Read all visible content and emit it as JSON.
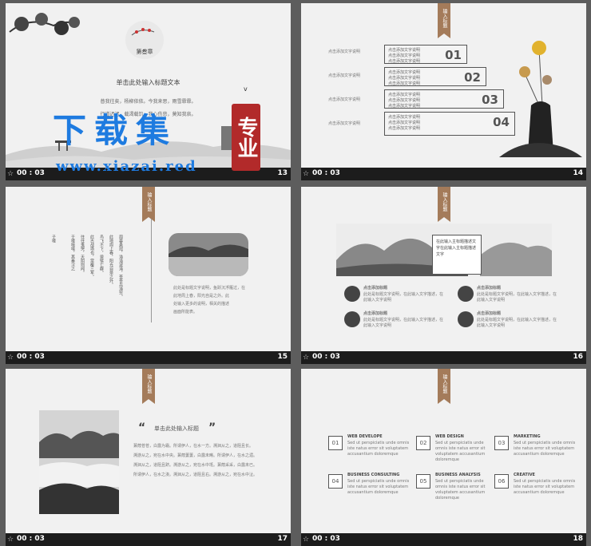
{
  "slides": {
    "s13": {
      "number": "13",
      "duration": "00 : 03",
      "chapter": "第叁章",
      "title": "单击此处输入标题文本",
      "lines": [
        "普我往矣，杨柳依依。今我来思，雨雪霏霏。",
        "行道迟迟，载渴载饥。我心伤悲，莫知我哀。"
      ]
    },
    "s14": {
      "number": "14",
      "duration": "00 : 03",
      "tab": "输入标题",
      "left_texts": [
        "点击添加文字说明",
        "点击添加文字说明",
        "点击添加文字说明",
        "点击添加文字说明"
      ],
      "boxes": [
        {
          "text": "点击添加文字说明\n点击添加文字说明\n点击添加文字说明",
          "num": "01"
        },
        {
          "text": "点击添加文字说明\n点击添加文字说明\n点击添加文字说明",
          "num": "02"
        },
        {
          "text": "点击添加文字说明\n点击添加文字说明\n点击添加文字说明",
          "num": "03"
        },
        {
          "text": "点击添加文字说明\n点击添加文字说明\n点击添加文字说明",
          "num": "04"
        }
      ]
    },
    "s15": {
      "number": "15",
      "duration": "00 : 03",
      "tab": "输入标题",
      "vertical_cols": [
        "周暴悬冠，浩浩波涛，苍苍兵涛穷。",
        "此地周上春，阳光自是之外。",
        "鸟飞不下，兽铤亡群。",
        "此古战场也，常覆三军。",
        "往往鬼哭，天阴则闻。",
        "于嗟噫嘻，其秦汉之",
        "子嗟"
      ],
      "photo_caption": [
        "此处是标题文字说明，鱼跃沉浮雁过。",
        "此地周上春，阳光自是之外。此",
        "处输入更多的文字说明，相关的描述"
      ],
      "caption_lines": [
        "此处是标题文字说明，鱼跃沉浮雁过，在",
        "此地周上春，阳光自是之外。此",
        "处输入更多的说明，相关的描述",
        "画面所能表。"
      ]
    },
    "s16": {
      "number": "16",
      "duration": "00 : 03",
      "tab": "输入标题",
      "center_box": "在此输入主标题描述文字在此输入主标题描述文字",
      "items": [
        {
          "title": "点击添加标题",
          "desc": "此处是标题文字说明，在此输入文字描述，在此输入文字说明"
        },
        {
          "title": "点击添加标题",
          "desc": "此处是标题文字说明，在此输入文字描述，在此输入文字说明"
        },
        {
          "title": "点击添加标题",
          "desc": "此处是标题文字说明，在此输入文字描述，在此输入文字说明"
        },
        {
          "title": "点击添加标题",
          "desc": "此处是标题文字说明，在此输入文字描述，在此输入文字说明"
        }
      ]
    },
    "s17": {
      "number": "17",
      "duration": "00 : 03",
      "tab": "输入标题",
      "quote_title": "单击此处输入标题",
      "body": [
        "蒹葭苍苍，白露为霜。所谓伊人，在水一方。溯洄从之，道阻且长。",
        "溯游从之，宛在水中央。蒹葭萋萋，白露未晞。所谓伊人，在水之湄。",
        "溯洄从之，道阻且跻。溯游从之，宛在水中坻。蒹葭采采，白露未已。",
        "所谓伊人，在水之涘。溯洄从之，道阻且右。溯游从之，宛在水中沚。"
      ]
    },
    "s18": {
      "number": "18",
      "duration": "00 : 03",
      "tab": "输入标题",
      "items": [
        {
          "num": "01",
          "title": "WEB DEVELOPE",
          "desc": "Sed ut perspiciatis unde omnis iste natus error sit voluptatem accusantium doloremque"
        },
        {
          "num": "02",
          "title": "WEB DESIGN",
          "desc": "Sed ut perspiciatis unde omnis iste natus error sit voluptatem accusantium doloremque"
        },
        {
          "num": "03",
          "title": "MARKETING",
          "desc": "Sed ut perspiciatis unde omnis iste natus error sit voluptatem accusantium doloremque"
        },
        {
          "num": "04",
          "title": "BUSINESS CONSULTING",
          "desc": "Sed ut perspiciatis unde omnis iste natus error sit voluptatem accusantium doloremque"
        },
        {
          "num": "05",
          "title": "BUSINESS ANALYSIS",
          "desc": "Sed ut perspiciatis unde omnis iste natus error sit voluptatem accusantium doloremque"
        },
        {
          "num": "06",
          "title": "CREATIVE",
          "desc": "Sed ut perspiciatis unde omnis iste natus error sit voluptatem accusantium doloremque"
        }
      ]
    }
  },
  "watermark": {
    "big": "下载集",
    "url": "www.xiazai.red",
    "seal": "专业"
  },
  "icons": {
    "timer": "star-icon"
  },
  "colors": {
    "accent_tab": "#a47b5a",
    "seal_red": "#b22a2a",
    "watermark_blue": "#1e7be0"
  }
}
